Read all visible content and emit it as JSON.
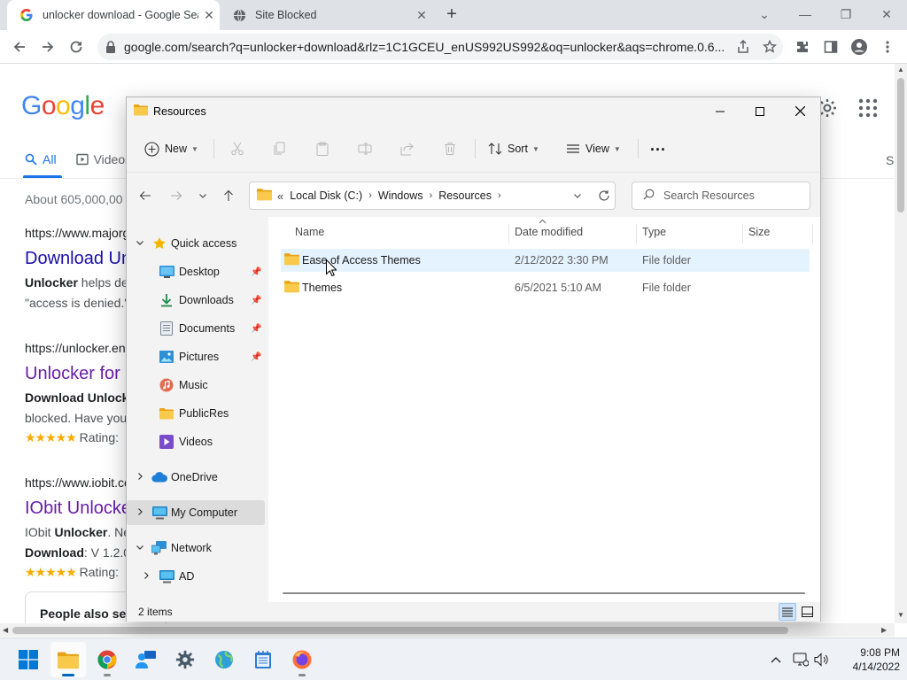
{
  "browser": {
    "tabs": [
      {
        "title": "unlocker download - Google Sea",
        "active": true,
        "favicon": "google-g-icon"
      },
      {
        "title": "Site Blocked",
        "active": false,
        "favicon": "globe-icon"
      }
    ],
    "url": "google.com/search?q=unlocker+download&rlz=1C1GCEU_enUS992US992&oq=unlocker&aqs=chrome.0.6..."
  },
  "google": {
    "logo": "Google",
    "tabs": [
      {
        "label": "All",
        "active": true
      },
      {
        "label": "Videos"
      }
    ],
    "right_tab": "S",
    "stats": "About 605,000,00",
    "results": [
      {
        "url": "https://www.majorg",
        "title": "Download Un",
        "snippet_bold": "Unlocker",
        "snippet1": " helps de",
        "snippet2": "\"access is denied.\"",
        "visited": false
      },
      {
        "url": "https://unlocker.en",
        "title": "Unlocker for",
        "snippet_bold": "Download Unlocke",
        "snippet1": "",
        "snippet2": "blocked. Have you",
        "rating": "Rating:",
        "visited": true
      },
      {
        "url": "https://www.iobit.co",
        "title": "IObit Unlocke",
        "snippet_pre": "IObit ",
        "snippet_bold": "Unlocker",
        "snippet1": ". Ne",
        "snippet2_bold": "Download",
        "snippet2": ": V 1.2.0",
        "rating": "Rating:",
        "visited": true
      }
    ],
    "paa": "People also sea"
  },
  "explorer": {
    "title": "Resources",
    "cmd": {
      "new": "New",
      "sort": "Sort",
      "view": "View",
      "more": "..."
    },
    "breadcrumb": {
      "root_chev": "«",
      "items": [
        "Local Disk (C:)",
        "Windows",
        "Resources"
      ]
    },
    "search_placeholder": "Search Resources",
    "nav": {
      "quick_access": "Quick access",
      "desktop": "Desktop",
      "downloads": "Downloads",
      "documents": "Documents",
      "pictures": "Pictures",
      "music": "Music",
      "publicres": "PublicRes",
      "videos": "Videos",
      "onedrive": "OneDrive",
      "my_computer": "My Computer",
      "network": "Network",
      "ad": "AD"
    },
    "columns": {
      "name": "Name",
      "date": "Date modified",
      "type": "Type",
      "size": "Size"
    },
    "files": [
      {
        "name": "Ease of Access Themes",
        "date": "2/12/2022 3:30 PM",
        "type": "File folder",
        "size": ""
      },
      {
        "name": "Themes",
        "date": "6/5/2021 5:10 AM",
        "type": "File folder",
        "size": ""
      }
    ],
    "status": "2 items"
  },
  "taskbar": {
    "time": "9:08 PM",
    "date": "4/14/2022"
  },
  "colors": {
    "accent": "#0067c0",
    "folder": "#f8c94a",
    "link": "#1a0dab",
    "visited": "#681da8"
  }
}
